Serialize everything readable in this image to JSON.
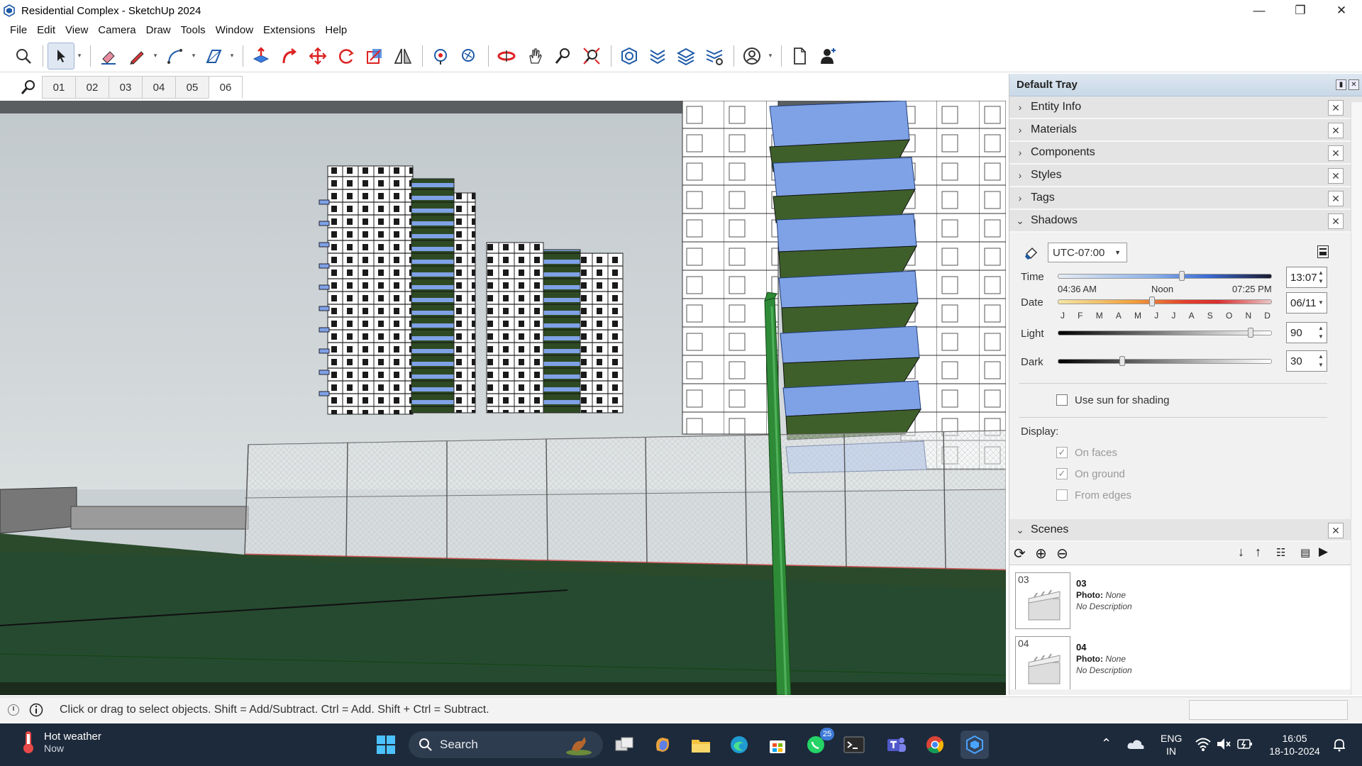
{
  "window": {
    "title": "Residential Complex - SketchUp 2024",
    "minimize": "—",
    "restore": "❐",
    "close": "✕"
  },
  "menu": [
    "File",
    "Edit",
    "View",
    "Camera",
    "Draw",
    "Tools",
    "Window",
    "Extensions",
    "Help"
  ],
  "toolbar": {
    "tools": [
      "search-tool",
      "select-tool",
      "eraser-tool",
      "pencil-tool",
      "arc-tool",
      "rectangle-tool",
      "push-pull-tool",
      "follow-me-tool",
      "move-tool",
      "rotate-tool",
      "scale-tool",
      "flip-tool",
      "paint-bucket-tool",
      "tape-measure-tool",
      "orbit-tool",
      "pan-tool",
      "zoom-tool",
      "zoom-extents-tool",
      "warehouse-icon",
      "extension-warehouse-icon",
      "layout-send-icon",
      "extension-manager-icon",
      "account-icon",
      "new-file-icon",
      "add-user-icon"
    ]
  },
  "scenes_tabs": {
    "tabs": [
      "01",
      "02",
      "03",
      "04",
      "05",
      "06"
    ],
    "active": "06"
  },
  "statusbar": {
    "message": "Click or drag to select objects. Shift = Add/Subtract. Ctrl = Add. Shift + Ctrl = Subtract."
  },
  "tray": {
    "title": "Default Tray",
    "panels": {
      "entity_info": "Entity Info",
      "materials": "Materials",
      "components": "Components",
      "styles": "Styles",
      "tags": "Tags",
      "shadows": "Shadows",
      "scenes": "Scenes"
    },
    "shadows": {
      "timezone": "UTC-07:00",
      "time_label": "Time",
      "time_start": "04:36 AM",
      "time_mid": "Noon",
      "time_end": "07:25 PM",
      "time_value": "13:07",
      "time_fraction": 0.58,
      "date_label": "Date",
      "months": [
        "J",
        "F",
        "M",
        "A",
        "M",
        "J",
        "J",
        "A",
        "S",
        "O",
        "N",
        "D"
      ],
      "date_value": "06/11",
      "date_fraction": 0.44,
      "light_label": "Light",
      "light_value": "90",
      "dark_label": "Dark",
      "dark_value": "30",
      "use_sun": "Use sun for shading",
      "use_sun_checked": false,
      "display_label": "Display:",
      "on_faces": "On faces",
      "on_faces_checked": true,
      "on_ground": "On ground",
      "on_ground_checked": true,
      "from_edges": "From edges",
      "from_edges_checked": false
    },
    "scenes": {
      "items": [
        {
          "thumb_num": "03",
          "name": "03",
          "photo_label": "Photo:",
          "photo_value": "None",
          "description": "No Description"
        },
        {
          "thumb_num": "04",
          "name": "04",
          "photo_label": "Photo:",
          "photo_value": "None",
          "description": "No Description"
        }
      ]
    }
  },
  "taskbar": {
    "weather_title": "Hot weather",
    "weather_sub": "Now",
    "search_label": "Search",
    "whatsapp_badge": "25",
    "lang_top": "ENG",
    "lang_bottom": "IN",
    "time": "16:05",
    "date": "18-10-2024"
  },
  "colors": {
    "sky": "#c9d0d3",
    "ground": "#2b4a2c",
    "glass": "#7fa2e6",
    "balcony_green": "#4a6b2e",
    "accent": "#2d6dd6"
  }
}
